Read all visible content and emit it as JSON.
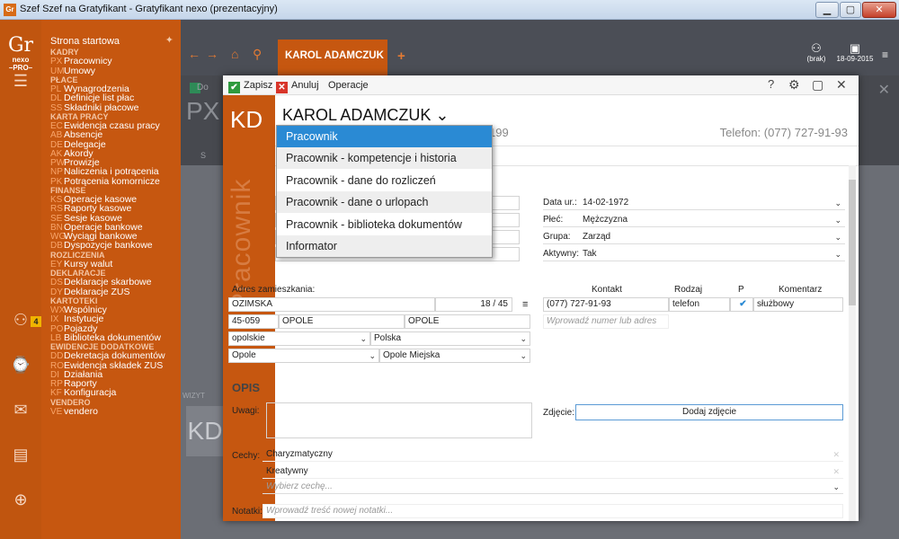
{
  "window": {
    "app_icon": "Gr",
    "title": "Szef Szef na Gratyfikant - Gratyfikant nexo (prezentacyjny)",
    "buttons": {
      "minimize": "▁",
      "maximize": "▢",
      "close": "✕"
    }
  },
  "left_rail": {
    "logo": {
      "main": "Gr",
      "line1": "nexo",
      "line2": "–PRO–"
    },
    "badge": "4"
  },
  "menu": {
    "items": [
      {
        "type": "start",
        "label": "Strona startowa"
      },
      {
        "type": "header",
        "label": "KADRY"
      },
      {
        "type": "item",
        "code": "PX",
        "label": "Pracownicy"
      },
      {
        "type": "item",
        "code": "UM",
        "label": "Umowy"
      },
      {
        "type": "header",
        "label": "PŁACE"
      },
      {
        "type": "item",
        "code": "PL",
        "label": "Wynagrodzenia"
      },
      {
        "type": "item",
        "code": "DL",
        "label": "Definicje list płac"
      },
      {
        "type": "item",
        "code": "SS",
        "label": "Składniki płacowe"
      },
      {
        "type": "header",
        "label": "KARTA PRACY"
      },
      {
        "type": "item",
        "code": "EC",
        "label": "Ewidencja czasu pracy"
      },
      {
        "type": "item",
        "code": "AB",
        "label": "Absencje"
      },
      {
        "type": "item",
        "code": "DE",
        "label": "Delegacje"
      },
      {
        "type": "item",
        "code": "AK",
        "label": "Akordy"
      },
      {
        "type": "item",
        "code": "PW",
        "label": "Prowizje"
      },
      {
        "type": "item",
        "code": "NP",
        "label": "Naliczenia i potrącenia"
      },
      {
        "type": "item",
        "code": "PK",
        "label": "Potrącenia komornicze"
      },
      {
        "type": "header",
        "label": "FINANSE"
      },
      {
        "type": "item",
        "code": "KS",
        "label": "Operacje kasowe"
      },
      {
        "type": "item",
        "code": "RS",
        "label": "Raporty kasowe"
      },
      {
        "type": "item",
        "code": "SE",
        "label": "Sesje kasowe"
      },
      {
        "type": "item",
        "code": "BN",
        "label": "Operacje bankowe"
      },
      {
        "type": "item",
        "code": "WG",
        "label": "Wyciągi bankowe"
      },
      {
        "type": "item",
        "code": "DB",
        "label": "Dyspozycje bankowe"
      },
      {
        "type": "header",
        "label": "ROZLICZENIA"
      },
      {
        "type": "item",
        "code": "EY",
        "label": "Kursy walut"
      },
      {
        "type": "header",
        "label": "DEKLARACJE"
      },
      {
        "type": "item",
        "code": "DS",
        "label": "Deklaracje skarbowe"
      },
      {
        "type": "item",
        "code": "DY",
        "label": "Deklaracje ZUS"
      },
      {
        "type": "header",
        "label": "KARTOTEKI"
      },
      {
        "type": "item",
        "code": "WX",
        "label": "Wspólnicy"
      },
      {
        "type": "item",
        "code": "IX",
        "label": "Instytucje"
      },
      {
        "type": "item",
        "code": "PO",
        "label": "Pojazdy"
      },
      {
        "type": "item",
        "code": "LB",
        "label": "Biblioteka dokumentów"
      },
      {
        "type": "header",
        "label": "EWIDENCJE DODATKOWE"
      },
      {
        "type": "item",
        "code": "DD",
        "label": "Dekretacja dokumentów"
      },
      {
        "type": "item",
        "code": "RO",
        "label": "Ewidencja składek ZUS"
      },
      {
        "type": "item",
        "code": "DI",
        "label": "Działania"
      },
      {
        "type": "item",
        "code": "RP",
        "label": "Raporty"
      },
      {
        "type": "item",
        "code": "KF",
        "label": "Konfiguracja"
      },
      {
        "type": "header",
        "label": "VENDERO"
      },
      {
        "type": "item",
        "code": "VE",
        "label": "vendero"
      }
    ]
  },
  "topbar": {
    "active_tab": "KAROL ADAMCZUK",
    "user_label": "(brak)",
    "date_label": "18-09-2015"
  },
  "background": {
    "px_code": "PX",
    "s_label": "S",
    "wiz_label": "WIZYT",
    "kd_label": "KD",
    "partial_d": "Do"
  },
  "toolbar": {
    "save_label": "Zapisz",
    "cancel_label": "Anuluj",
    "operations_label": "Operacje",
    "help_label": "?"
  },
  "employee": {
    "initials": "KD",
    "side_word": "Pracownik",
    "name": "KAROL ADAMCZUK ⌄",
    "partial_id": "199",
    "phone": "Telefon: (077) 727-91-93"
  },
  "dropdown": {
    "items": [
      "Pracownik",
      "Pracownik - kompetencje i historia",
      "Pracownik - dane do rozliczeń",
      "Pracownik - dane o urlopach",
      "Pracownik - biblioteka dokumentów",
      "Informator"
    ],
    "selected_index": 0
  },
  "personal": {
    "birth_label": "Data ur.:",
    "birth_value": "14-02-1972",
    "sex_label": "Płeć:",
    "sex_value": "Mężczyzna",
    "group_label": "Grupa:",
    "group_value": "Zarząd",
    "active_label": "Aktywny:",
    "active_value": "Tak"
  },
  "address": {
    "label": "Adres zamieszkania:",
    "street": "OZIMSKA",
    "house": "18",
    "slash": "/",
    "flat": "45",
    "postcode": "45-059",
    "city": "OPOLE",
    "post_city": "OPOLE",
    "voivodeship": "opolskie",
    "country": "Polska",
    "county": "Opole",
    "commune": "Opole",
    "commune_type": "Miejska"
  },
  "contacts": {
    "headers": [
      "Kontakt",
      "Rodzaj",
      "P",
      "Komentarz"
    ],
    "rows": [
      {
        "value": "(077) 727-91-93",
        "type": "telefon",
        "primary": "✔",
        "comment": "służbowy"
      }
    ],
    "placeholder": "Wprowadź numer lub adres"
  },
  "opis": {
    "title": "OPIS",
    "notes_label": "Uwagi:",
    "photo_label": "Zdjęcie:",
    "photo_button": "Dodaj zdjęcie",
    "traits_label": "Cechy:",
    "traits": [
      "Charyzmatyczny",
      "Kreatywny"
    ],
    "trait_placeholder": "Wybierz cechę...",
    "memo_label": "Notatki:",
    "memo_placeholder": "Wprowadź treść nowej notatki..."
  }
}
